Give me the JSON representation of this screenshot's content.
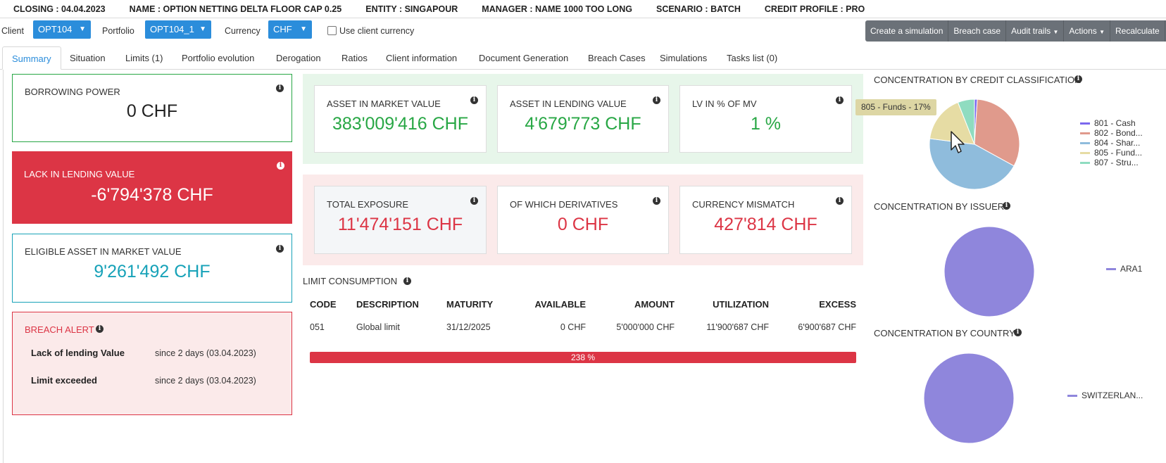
{
  "header": {
    "closing": "CLOSING : 04.04.2023",
    "name": "NAME : OPTION NETTING DELTA FLOOR CAP 0.25",
    "entity": "ENTITY : SINGAPOUR",
    "manager": "MANAGER : NAME 1000 TOO LONG",
    "scenario": "SCENARIO : BATCH",
    "credit_profile": "CREDIT PROFILE : PRO"
  },
  "filters": {
    "client_label": "Client",
    "client_value": "OPT104",
    "portfolio_label": "Portfolio",
    "portfolio_value": "OPT104_1",
    "currency_label": "Currency",
    "currency_value": "CHF",
    "use_client_currency": "Use client currency"
  },
  "actions": {
    "create_simulation": "Create a simulation",
    "breach_case": "Breach case",
    "audit_trails": "Audit trails",
    "actions": "Actions",
    "recalculate": "Recalculate"
  },
  "tabs": [
    "Summary",
    "Situation",
    "Limits (1)",
    "Portfolio evolution",
    "Derogation",
    "Ratios",
    "Client information",
    "Document Generation",
    "Breach Cases",
    "Simulations",
    "Tasks list (0)"
  ],
  "left": {
    "borrowing_power": {
      "title": "BORROWING POWER",
      "value": "0 CHF"
    },
    "lack_lending": {
      "title": "LACK IN LENDING VALUE",
      "value": "-6'794'378 CHF"
    },
    "eligible_asset": {
      "title": "ELIGIBLE ASSET IN MARKET VALUE",
      "value": "9'261'492 CHF"
    },
    "breach_alert": {
      "title": "BREACH ALERT",
      "items": [
        {
          "label": "Lack of lending Value",
          "since": "since 2 days (03.04.2023)"
        },
        {
          "label": "Limit exceeded",
          "since": "since 2 days (03.04.2023)"
        }
      ]
    }
  },
  "kpis_green": [
    {
      "title": "ASSET IN MARKET VALUE",
      "value": "383'009'416 CHF"
    },
    {
      "title": "ASSET IN LENDING VALUE",
      "value": "4'679'773 CHF"
    },
    {
      "title": "LV IN % OF MV",
      "value": "1 %"
    }
  ],
  "kpis_red": [
    {
      "title": "TOTAL EXPOSURE",
      "value": "11'474'151 CHF"
    },
    {
      "title": "OF WHICH DERIVATIVES",
      "value": "0 CHF"
    },
    {
      "title": "CURRENCY MISMATCH",
      "value": "427'814 CHF"
    }
  ],
  "limit_consumption": {
    "title": "LIMIT CONSUMPTION",
    "headers": [
      "CODE",
      "DESCRIPTION",
      "MATURITY",
      "AVAILABLE",
      "AMOUNT",
      "UTILIZATION",
      "EXCESS"
    ],
    "row": [
      "051",
      "Global limit",
      "31/12/2025",
      "0 CHF",
      "5'000'000 CHF",
      "11'900'687 CHF",
      "6'900'687 CHF"
    ],
    "utilization_label": "238 %",
    "utilization_percent": 238
  },
  "concentration": {
    "credit_title": "CONCENTRATION BY CREDIT CLASSIFICATION",
    "tooltip": "805 - Funds - 17%",
    "issuer_title": "CONCENTRATION BY ISSUER",
    "country_title": "CONCENTRATION BY COUNTRY",
    "credit_legend": [
      "801 - Cash",
      "802 - Bond...",
      "804 - Shar...",
      "805 - Fund...",
      "807 - Stru..."
    ],
    "issuer_legend": [
      "ARA1"
    ],
    "country_legend": [
      "SWITZERLAN..."
    ]
  },
  "chart_data": [
    {
      "type": "pie",
      "title": "CONCENTRATION BY CREDIT CLASSIFICATION",
      "categories": [
        "801 - Cash",
        "802 - Bond...",
        "804 - Shar...",
        "805 - Fund...",
        "807 - Stru..."
      ],
      "values": [
        1,
        32,
        44,
        17,
        6
      ],
      "colors": [
        "#7b68ee",
        "#e09a8c",
        "#8fbcdc",
        "#e6dca4",
        "#8fdcc0"
      ],
      "legend": "right"
    },
    {
      "type": "pie",
      "title": "CONCENTRATION BY ISSUER",
      "categories": [
        "ARA1"
      ],
      "values": [
        100
      ],
      "colors": [
        "#8f86dc"
      ],
      "legend": "right"
    },
    {
      "type": "pie",
      "title": "CONCENTRATION BY COUNTRY",
      "categories": [
        "SWITZERLAN..."
      ],
      "values": [
        100
      ],
      "colors": [
        "#8f86dc"
      ],
      "legend": "right"
    }
  ],
  "colors": {
    "primary": "#2b8ddb",
    "green": "#28a745",
    "red": "#dc3545",
    "teal": "#17a2b8",
    "green_bg": "#e7f6ea",
    "red_bg": "#fbeaea",
    "button_gray": "#6b7178",
    "tooltip_bg": "#ddd6a4"
  }
}
